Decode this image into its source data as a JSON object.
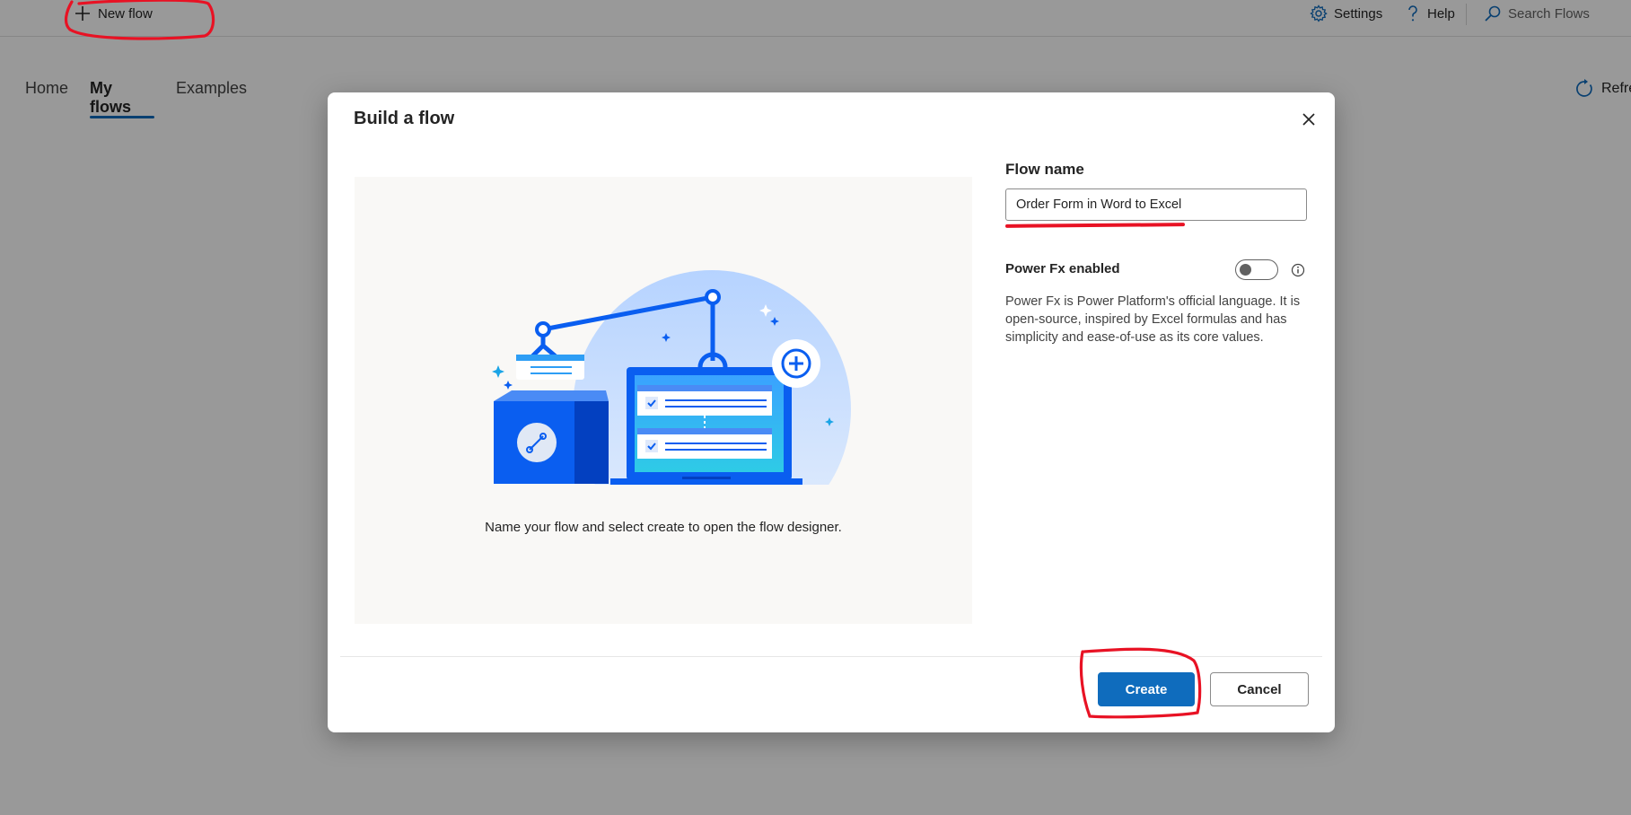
{
  "topbar": {
    "new_flow_label": "New flow",
    "settings_label": "Settings",
    "help_label": "Help",
    "search_placeholder": "Search Flows"
  },
  "tabs": [
    {
      "label": "Home",
      "active": false
    },
    {
      "label": "My flows",
      "active": true
    },
    {
      "label": "Examples",
      "active": false
    }
  ],
  "refresh_label": "Refre",
  "dialog": {
    "title": "Build a flow",
    "caption": "Name your flow and select create to open the flow designer.",
    "flow_name_label": "Flow name",
    "flow_name_value": "Order Form in Word to Excel",
    "power_fx_label": "Power Fx enabled",
    "power_fx_enabled": false,
    "power_fx_description": "Power Fx is Power Platform's official language. It is open-source, inspired by Excel formulas and has simplicity and ease-of-use as its core values.",
    "create_label": "Create",
    "cancel_label": "Cancel"
  },
  "colors": {
    "accent": "#0f6cbd",
    "annotation": "#e81224",
    "illustration_blue": "#0a5ef0"
  },
  "icons": [
    "plus-icon",
    "gear-icon",
    "question-icon",
    "search-icon",
    "refresh-icon",
    "close-icon",
    "info-icon"
  ]
}
